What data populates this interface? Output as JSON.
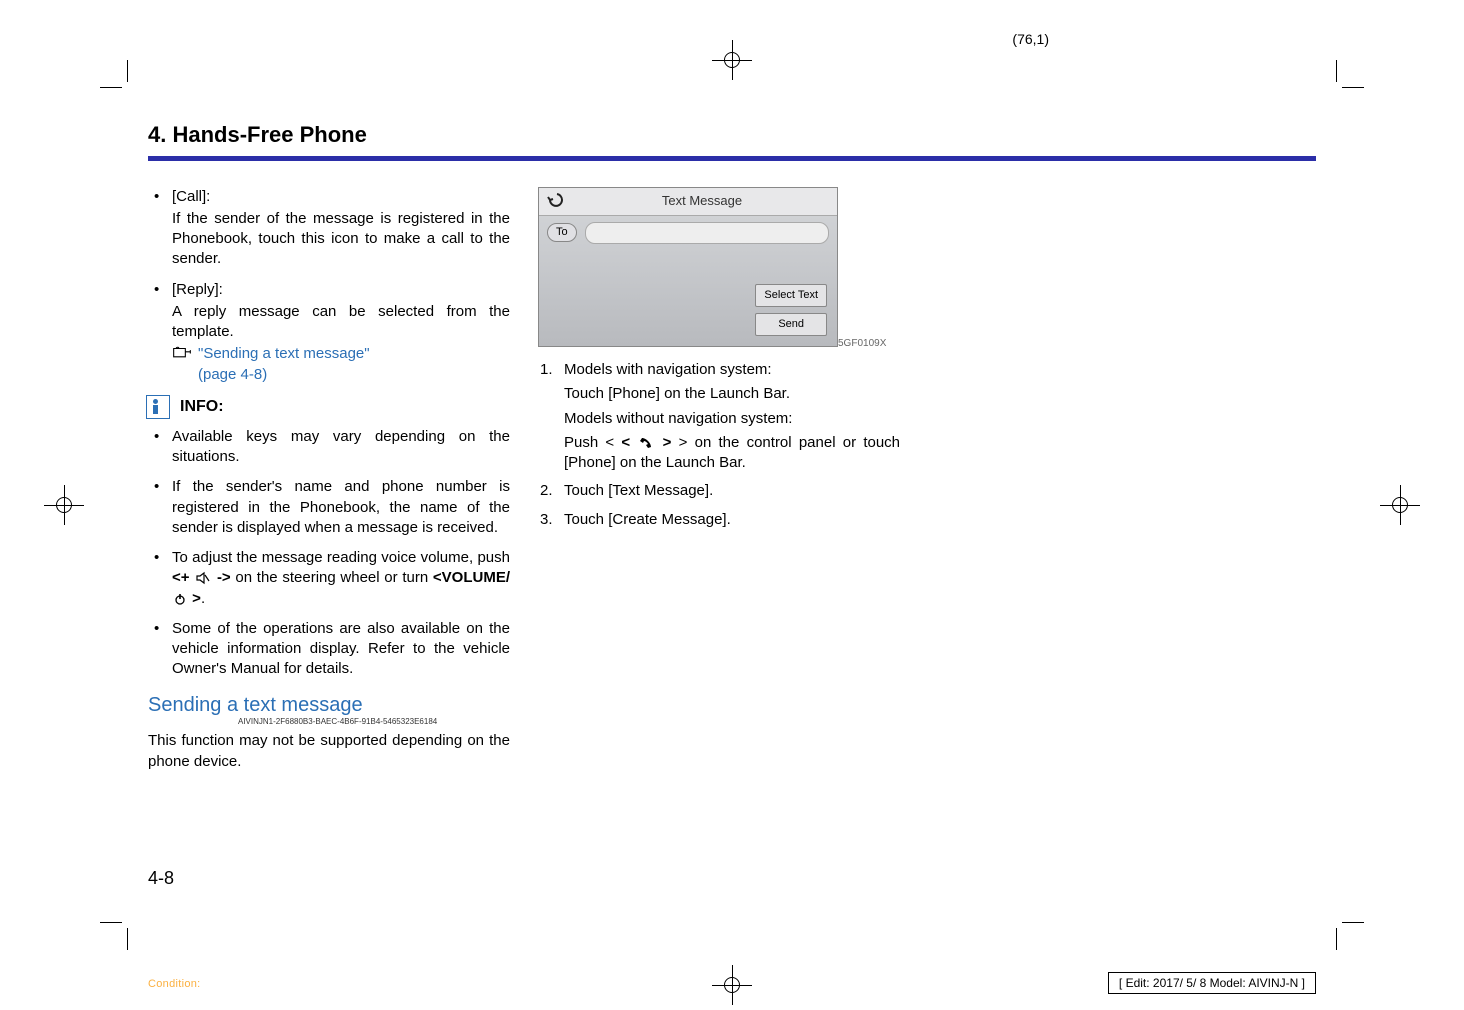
{
  "page_coord": "(76,1)",
  "chapter_title": "4. Hands-Free Phone",
  "col1": {
    "items": [
      {
        "label": "[Call]:",
        "desc": "If the sender of the message is registered in the Phonebook, touch this icon to make a call to the sender."
      },
      {
        "label": "[Reply]:",
        "desc": "A reply message can be selected from the template.",
        "ref_text": "\"Sending a text message\"",
        "ref_page": "(page 4-8)"
      }
    ],
    "info_label": "INFO:",
    "info_bullets": [
      "Available keys may vary depending on the situations.",
      "If the sender's name and phone number is registered in the Phonebook, the name of the sender is displayed when a message is received.",
      "To adjust the message reading voice volume, push <+ 🔇 -> on the steering wheel or turn <VOLUME/ ⏻ >.",
      "Some of the operations are also available on the vehicle information display. Refer to the vehicle Owner's Manual for details."
    ],
    "heading_sub": "Sending a text message",
    "guid": "AIVINJN1-2F6880B3-BAEC-4B6F-91B4-5465323E6184",
    "note": "This function may not be supported depending on the phone device."
  },
  "col2": {
    "screenshot": {
      "title": "Text Message",
      "to_label": "To",
      "select_text_btn": "Select Text",
      "send_btn": "Send",
      "code": "5GF0109X"
    },
    "steps": [
      {
        "line1": "Models with navigation system:",
        "line2": "Touch [Phone] on the Launch Bar.",
        "line3": "Models without navigation system:",
        "line4a": "Push < ",
        "line4b": " > on the control panel or touch [Phone] on the Launch Bar."
      },
      {
        "text": "Touch [Text Message]."
      },
      {
        "text": "Touch [Create Message]."
      }
    ]
  },
  "page_number": "4-8",
  "condition": "Condition:",
  "edit_info": "[ Edit: 2017/ 5/ 8   Model: AIVINJ-N ]"
}
